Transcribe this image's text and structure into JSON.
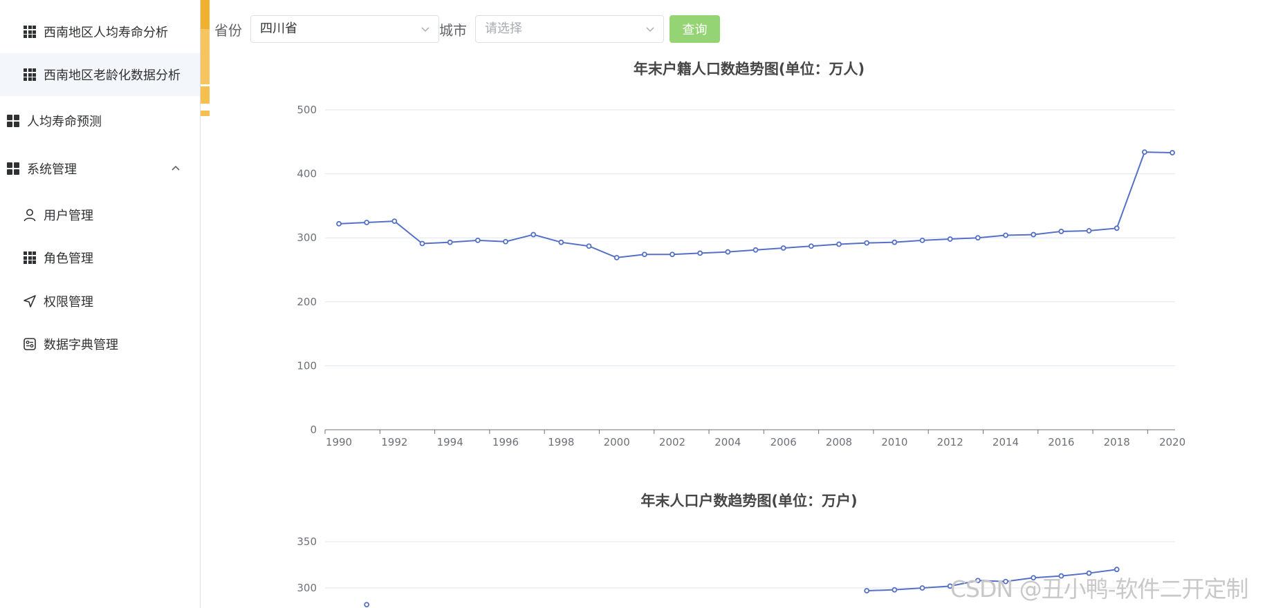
{
  "sidebar": {
    "items": [
      {
        "label": "西南地区人均寿命分析",
        "icon": "grid-icon"
      },
      {
        "label": "西南地区老龄化数据分析",
        "icon": "grid-icon"
      },
      {
        "label": "人均寿命预测",
        "icon": "apps-icon"
      },
      {
        "label": "系统管理",
        "icon": "apps-icon"
      },
      {
        "label": "用户管理",
        "icon": "user-icon"
      },
      {
        "label": "角色管理",
        "icon": "grid-icon"
      },
      {
        "label": "权限管理",
        "icon": "send-icon"
      },
      {
        "label": "数据字典管理",
        "icon": "dictionary-icon"
      }
    ]
  },
  "filter": {
    "province_label": "省份",
    "province_value": "四川省",
    "city_label": "城市",
    "city_placeholder": "请选择",
    "query_label": "查询"
  },
  "colors": {
    "accent": "#f0b030",
    "line": "#5470c6",
    "query_button": "#95d475"
  },
  "watermark": "CSDN @丑小鸭-软件二开定制",
  "chart_data": [
    {
      "type": "line",
      "title": "年末户籍人口数趋势图(单位：万人)",
      "x": [
        1990,
        1991,
        1992,
        1993,
        1994,
        1995,
        1996,
        1997,
        1998,
        1999,
        2000,
        2001,
        2002,
        2003,
        2004,
        2005,
        2006,
        2007,
        2008,
        2009,
        2010,
        2011,
        2012,
        2013,
        2014,
        2015,
        2016,
        2017,
        2018,
        2019,
        2020
      ],
      "values": [
        322,
        324,
        326,
        291,
        293,
        296,
        294,
        305,
        293,
        287,
        269,
        274,
        274,
        276,
        278,
        281,
        284,
        287,
        290,
        292,
        293,
        296,
        298,
        300,
        304,
        305,
        310,
        311,
        315,
        434,
        433
      ],
      "x_tick_labels": [
        "1990",
        "1992",
        "1994",
        "1996",
        "1998",
        "2000",
        "2002",
        "2004",
        "2006",
        "2008",
        "2010",
        "2012",
        "2014",
        "2016",
        "2018",
        "2020"
      ],
      "y_tick_labels": [
        "0",
        "100",
        "200",
        "300",
        "400",
        "500"
      ],
      "ylim": [
        0,
        500
      ],
      "grid": true
    },
    {
      "type": "line",
      "title": "年末人口户数趋势图(单位：万户)",
      "x": [
        1991,
        2009,
        2010,
        2011,
        2012,
        2013,
        2014,
        2015,
        2016,
        2017,
        2018
      ],
      "values": [
        282,
        297,
        298,
        300,
        302,
        308,
        307,
        311,
        313,
        316,
        320
      ],
      "y_tick_labels": [
        "300",
        "350"
      ],
      "grid": true
    }
  ]
}
